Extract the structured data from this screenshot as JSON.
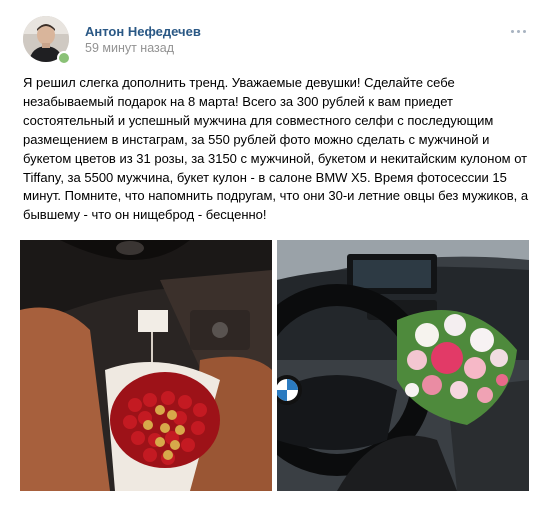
{
  "post": {
    "author": "Антон Нефедечев",
    "time": "59 минут назад",
    "text": "Я решил слегка дополнить тренд. Уважаемые девушки! Сделайте себе незабываемый подарок на 8 марта! Всего за 300 рублей к вам приедет состоятельный и успешный мужчина для совместного селфи с последующим размещением в инстаграм, за 550 рублей фото можно сделать с мужчиной и букетом цветов из 31 розы, за 3150 с мужчиной, букетом и некитайским кулоном от Tiffany, за 5500 мужчина, букет кулон - в салоне BMW X5. Время фотосессии 15 минут. Помните, что напомнить подругам, что они 30-и летние овцы без мужиков, а бывшему - что он нищеброд - бесценно!",
    "online": true
  },
  "photos": [
    {
      "icon": "car-interior-roses-bouquet-photo"
    },
    {
      "icon": "car-steering-wheel-flowers-photo"
    }
  ],
  "colors": {
    "author_link": "#2a5885",
    "secondary_text": "#939393",
    "online_indicator": "#8ac176",
    "more_dots": "#a8b3c1"
  }
}
